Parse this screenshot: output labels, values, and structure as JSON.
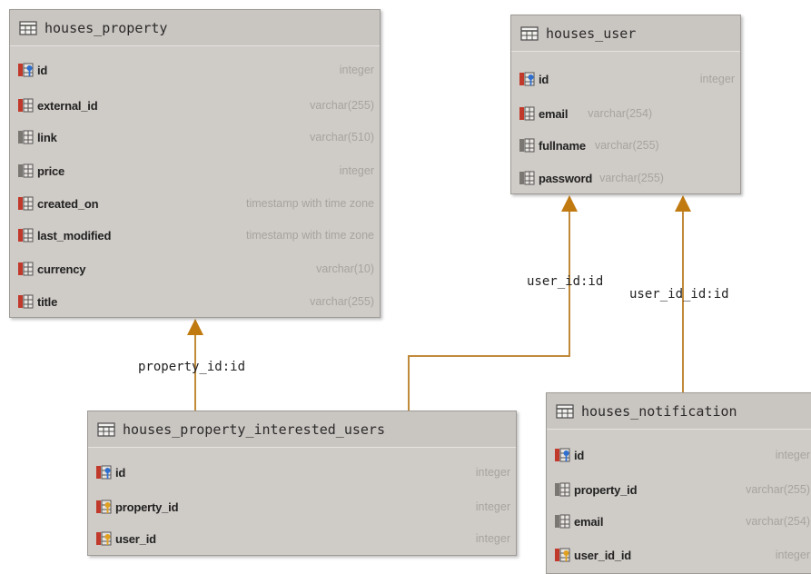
{
  "tables": {
    "property": {
      "name": "houses_property",
      "columns": [
        {
          "name": "id",
          "type": "integer",
          "icon": "primary-key-icon"
        },
        {
          "name": "external_id",
          "type": "varchar(255)",
          "icon": "column-icon"
        },
        {
          "name": "link",
          "type": "varchar(510)",
          "icon": "column-icon"
        },
        {
          "name": "price",
          "type": "integer",
          "icon": "column-icon"
        },
        {
          "name": "created_on",
          "type": "timestamp with time zone",
          "icon": "column-icon"
        },
        {
          "name": "last_modified",
          "type": "timestamp with time zone",
          "icon": "column-icon"
        },
        {
          "name": "currency",
          "type": "varchar(10)",
          "icon": "column-icon"
        },
        {
          "name": "title",
          "type": "varchar(255)",
          "icon": "column-icon"
        }
      ]
    },
    "user": {
      "name": "houses_user",
      "columns": [
        {
          "name": "id",
          "type": "integer",
          "icon": "primary-key-icon"
        },
        {
          "name": "email",
          "type": "varchar(254)",
          "icon": "column-icon"
        },
        {
          "name": "fullname",
          "type": "varchar(255)",
          "icon": "column-icon"
        },
        {
          "name": "password",
          "type": "varchar(255)",
          "icon": "column-icon"
        }
      ]
    },
    "interested": {
      "name": "houses_property_interested_users",
      "columns": [
        {
          "name": "id",
          "type": "integer",
          "icon": "primary-key-icon"
        },
        {
          "name": "property_id",
          "type": "integer",
          "icon": "foreign-key-icon"
        },
        {
          "name": "user_id",
          "type": "integer",
          "icon": "foreign-key-icon"
        }
      ]
    },
    "notification": {
      "name": "houses_notification",
      "columns": [
        {
          "name": "id",
          "type": "integer",
          "icon": "primary-key-icon"
        },
        {
          "name": "property_id",
          "type": "varchar(255)",
          "icon": "column-icon"
        },
        {
          "name": "email",
          "type": "varchar(254)",
          "icon": "column-icon"
        },
        {
          "name": "user_id_id",
          "type": "integer",
          "icon": "foreign-key-icon"
        }
      ]
    }
  },
  "relations": {
    "property_id": "property_id:id",
    "user_id": "user_id:id",
    "user_id_id": "user_id_id:id"
  },
  "colors": {
    "connector": "#b8860b",
    "table_bg": "#cfcbc7",
    "type_text": "#a7a4a0"
  }
}
